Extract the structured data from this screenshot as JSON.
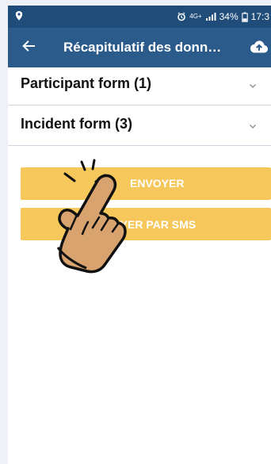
{
  "status_bar": {
    "network": "4G+",
    "battery": "34%",
    "time": "17:3"
  },
  "header": {
    "title": "Récapitulatif des donn…"
  },
  "sections": [
    {
      "label": "Participant form (1)"
    },
    {
      "label": "Incident form (3)"
    }
  ],
  "buttons": {
    "send": "ENVOYER",
    "send_sms": "ENVOYER PAR SMS"
  },
  "icons": {
    "status_left": "location-pin-icon",
    "alarm": "alarm-icon",
    "signal": "signal-icon",
    "battery": "battery-icon",
    "back": "arrow-left-icon",
    "upload": "cloud-upload-icon",
    "chevron": "chevron-down-icon",
    "tap_overlay": "pointing-hand-icon"
  },
  "colors": {
    "status_bar": "#1f4c79",
    "app_bar": "#2b5b8a",
    "button": "#f6c75a",
    "background": "#ffffff"
  }
}
